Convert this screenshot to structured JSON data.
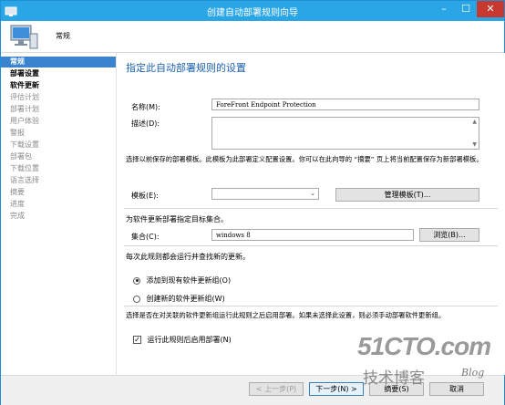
{
  "window": {
    "title": "创建自动部署规则向导"
  },
  "header": {
    "title": "常规"
  },
  "sidebar": {
    "items": [
      {
        "label": "常规",
        "state": "active"
      },
      {
        "label": "部署设置",
        "state": "bold"
      },
      {
        "label": "软件更新",
        "state": "bold"
      },
      {
        "label": "评估计划",
        "state": "normal"
      },
      {
        "label": "部署计划",
        "state": "normal"
      },
      {
        "label": "用户体验",
        "state": "normal"
      },
      {
        "label": "警报",
        "state": "normal"
      },
      {
        "label": "下载设置",
        "state": "normal"
      },
      {
        "label": "部署包",
        "state": "normal"
      },
      {
        "label": "下载位置",
        "state": "normal"
      },
      {
        "label": "语言选择",
        "state": "normal"
      },
      {
        "label": "摘要",
        "state": "normal"
      },
      {
        "label": "进度",
        "state": "normal"
      },
      {
        "label": "完成",
        "state": "normal"
      }
    ]
  },
  "main": {
    "heading": "指定此自动部署规则的设置",
    "name_label": "名称(M):",
    "name_value": "ForeFront Endpoint Protection",
    "desc_label": "描述(D):",
    "desc_value": "",
    "template_hint": "选择以前保存的部署模板。此模板为此部署定义配置设置。你可以在此向导的 “摘要” 页上将当前配置保存为新部署模板。",
    "template_label": "模板(E):",
    "template_value": "",
    "manage_templates_button": "管理模板(T)...",
    "collection_hint": "为软件更新部署指定目标集合。",
    "collection_label": "集合(C):",
    "collection_value": "windows 8",
    "browse_button": "浏览(B)...",
    "run_hint": "每次此规则都会运行并查找新的更新。",
    "radio_add_existing": "添加到现有软件更新组(O)",
    "radio_create_new": "创建新的软件更新组(W)",
    "enable_hint": "选择是否在对关联的软件更新组运行此规则之后启用部署。如果未选择此设置，则必须手动部署软件更新组。",
    "enable_checkbox": "运行此规则后启用部署(N)"
  },
  "footer": {
    "prev_button": "< 上一步(P)",
    "next_button": "下一步(N) >",
    "summary_button": "摘要(S)",
    "cancel_button": "取消"
  },
  "watermark": {
    "big": "51CTO.com",
    "small": "技术博客",
    "blog": "Blog"
  },
  "colors": {
    "titlebar": "#2aa6e6",
    "active_item": "#3a84cf",
    "heading": "#1b61b5",
    "close": "#c7382f"
  }
}
